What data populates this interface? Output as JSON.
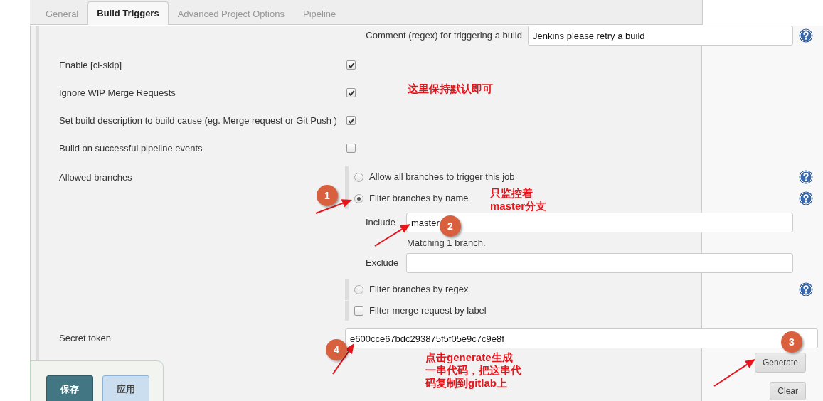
{
  "tabs": [
    {
      "label": "General",
      "selected": false
    },
    {
      "label": "Build Triggers",
      "selected": true
    },
    {
      "label": "Advanced Project Options",
      "selected": false
    },
    {
      "label": "Pipeline",
      "selected": false
    }
  ],
  "trigger_comment": {
    "label": "Comment (regex) for triggering a build",
    "value": "Jenkins please retry a build",
    "help": true
  },
  "options": [
    {
      "label": "Enable [ci-skip]",
      "checked": true
    },
    {
      "label": "Ignore WIP Merge Requests",
      "checked": true
    },
    {
      "label": "Set build description to build cause (eg. Merge request or Git Push )",
      "checked": true
    },
    {
      "label": "Build on successful pipeline events",
      "checked": false
    }
  ],
  "allowed_branches": {
    "label": "Allowed branches",
    "items": [
      {
        "kind": "radio",
        "label": "Allow all branches to trigger this job",
        "selected": false,
        "help": true
      },
      {
        "kind": "radio",
        "label": "Filter branches by name",
        "selected": true,
        "help": true
      },
      {
        "kind": "field",
        "label": "Include",
        "value": "master",
        "note": "Matching 1 branch."
      },
      {
        "kind": "field",
        "label": "Exclude"
      },
      {
        "kind": "radio",
        "label": "Filter branches by regex",
        "selected": false,
        "help": true
      },
      {
        "kind": "checkbox",
        "label": "Filter merge request by label",
        "checked": false
      }
    ]
  },
  "secret_token": {
    "label": "Secret token",
    "value": "e600cce67bdc293875f5f05e9c7c9e8f",
    "buttons": [
      "Generate",
      "Clear"
    ]
  },
  "footer_buttons": [
    {
      "label": "保存",
      "kind": "primary"
    },
    {
      "label": "应用",
      "kind": "secondary"
    }
  ],
  "annotations": [
    {
      "kind": "note",
      "lines": [
        "这里保持默认即可"
      ]
    },
    {
      "kind": "note",
      "lines": [
        "只监控着",
        "master分支"
      ]
    },
    {
      "kind": "note",
      "lines": [
        "点击generate生成",
        "一串代码，把这串代",
        "码复制到gitlab上"
      ]
    },
    {
      "kind": "marker",
      "label": "1"
    },
    {
      "kind": "marker",
      "label": "2"
    },
    {
      "kind": "marker",
      "label": "3"
    },
    {
      "kind": "marker",
      "label": "4"
    }
  ]
}
